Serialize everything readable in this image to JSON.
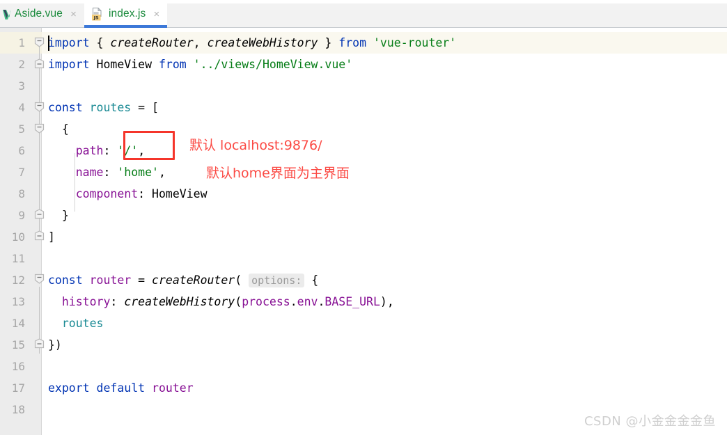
{
  "window": {
    "app": "IntelliJ-like IDE editor",
    "background_color": "#ffffff"
  },
  "tabbar": {
    "tabs": [
      {
        "label": "Aside.vue",
        "icon": "vue-file-icon",
        "close_glyph": "×",
        "active": false,
        "label_color": "#1a8a3c"
      },
      {
        "label": "index.js",
        "icon": "js-file-icon",
        "icon_badge": "JS",
        "close_glyph": "×",
        "active": true,
        "label_color": "#1a8a3c",
        "active_underline_color": "#3c78d8"
      }
    ]
  },
  "editor": {
    "gutter": {
      "line_numbers": [
        "1",
        "2",
        "3",
        "4",
        "5",
        "6",
        "7",
        "8",
        "9",
        "10",
        "11",
        "12",
        "13",
        "14",
        "15",
        "16",
        "17",
        "18"
      ]
    },
    "current_line": 1,
    "current_line_highlight_color": "#faf8ef",
    "caret_line": 1,
    "lines": [
      {
        "n": "1",
        "tokens": [
          {
            "t": "import",
            "c": "kw"
          },
          {
            "t": " ",
            "c": "pl"
          },
          {
            "t": "{",
            "c": "pl"
          },
          {
            "t": " ",
            "c": "pl"
          },
          {
            "t": "createRouter",
            "c": "fn"
          },
          {
            "t": ", ",
            "c": "pl"
          },
          {
            "t": "createWebHistory",
            "c": "fn"
          },
          {
            "t": " ",
            "c": "pl"
          },
          {
            "t": "}",
            "c": "pl"
          },
          {
            "t": " ",
            "c": "pl"
          },
          {
            "t": "from",
            "c": "kw"
          },
          {
            "t": " ",
            "c": "pl"
          },
          {
            "t": "'vue-router'",
            "c": "str"
          }
        ]
      },
      {
        "n": "2",
        "tokens": [
          {
            "t": "import",
            "c": "kw"
          },
          {
            "t": " ",
            "c": "pl"
          },
          {
            "t": "HomeView",
            "c": "pl"
          },
          {
            "t": " ",
            "c": "pl"
          },
          {
            "t": "from",
            "c": "kw"
          },
          {
            "t": " ",
            "c": "pl"
          },
          {
            "t": "'../views/HomeView.vue'",
            "c": "str"
          }
        ]
      },
      {
        "n": "3",
        "tokens": []
      },
      {
        "n": "4",
        "tokens": [
          {
            "t": "const",
            "c": "kw"
          },
          {
            "t": " ",
            "c": "pl"
          },
          {
            "t": "routes",
            "c": "cyan"
          },
          {
            "t": " = [",
            "c": "pl"
          }
        ]
      },
      {
        "n": "5",
        "tokens": [
          {
            "t": "  {",
            "c": "pl"
          }
        ]
      },
      {
        "n": "6",
        "tokens": [
          {
            "t": "    ",
            "c": "pl"
          },
          {
            "t": "path",
            "c": "prop"
          },
          {
            "t": ": ",
            "c": "pl"
          },
          {
            "t": "'/'",
            "c": "str"
          },
          {
            "t": ",",
            "c": "pl"
          }
        ]
      },
      {
        "n": "7",
        "tokens": [
          {
            "t": "    ",
            "c": "pl"
          },
          {
            "t": "name",
            "c": "prop"
          },
          {
            "t": ": ",
            "c": "pl"
          },
          {
            "t": "'home'",
            "c": "str"
          },
          {
            "t": ",",
            "c": "pl"
          }
        ]
      },
      {
        "n": "8",
        "tokens": [
          {
            "t": "    ",
            "c": "pl"
          },
          {
            "t": "component",
            "c": "prop"
          },
          {
            "t": ": ",
            "c": "pl"
          },
          {
            "t": "HomeView",
            "c": "pl"
          }
        ]
      },
      {
        "n": "9",
        "tokens": [
          {
            "t": "  }",
            "c": "pl"
          }
        ]
      },
      {
        "n": "10",
        "tokens": [
          {
            "t": "]",
            "c": "pl"
          }
        ]
      },
      {
        "n": "11",
        "tokens": []
      },
      {
        "n": "12",
        "tokens": [
          {
            "t": "const",
            "c": "kw"
          },
          {
            "t": " ",
            "c": "pl"
          },
          {
            "t": "router",
            "c": "prop"
          },
          {
            "t": " = ",
            "c": "pl"
          },
          {
            "t": "createRouter",
            "c": "fn"
          },
          {
            "t": "( ",
            "c": "pl"
          },
          {
            "t": "options:",
            "c": "hint"
          },
          {
            "t": " {",
            "c": "pl"
          }
        ]
      },
      {
        "n": "13",
        "tokens": [
          {
            "t": "  ",
            "c": "pl"
          },
          {
            "t": "history",
            "c": "prop"
          },
          {
            "t": ": ",
            "c": "pl"
          },
          {
            "t": "createWebHistory",
            "c": "fn"
          },
          {
            "t": "(",
            "c": "pl"
          },
          {
            "t": "process",
            "c": "prop"
          },
          {
            "t": ".",
            "c": "pl"
          },
          {
            "t": "env",
            "c": "prop"
          },
          {
            "t": ".",
            "c": "pl"
          },
          {
            "t": "BASE_URL",
            "c": "prop"
          },
          {
            "t": "),",
            "c": "pl"
          }
        ]
      },
      {
        "n": "14",
        "tokens": [
          {
            "t": "  ",
            "c": "pl"
          },
          {
            "t": "routes",
            "c": "cyan"
          }
        ]
      },
      {
        "n": "15",
        "tokens": [
          {
            "t": "})",
            "c": "pl"
          }
        ]
      },
      {
        "n": "16",
        "tokens": []
      },
      {
        "n": "17",
        "tokens": [
          {
            "t": "export",
            "c": "kw"
          },
          {
            "t": " ",
            "c": "pl"
          },
          {
            "t": "default",
            "c": "kw"
          },
          {
            "t": " ",
            "c": "pl"
          },
          {
            "t": "router",
            "c": "prop"
          }
        ]
      },
      {
        "n": "18",
        "tokens": []
      }
    ]
  },
  "annotations": {
    "box_color": "#f5352b",
    "text_color": "#fb4a44",
    "items": [
      {
        "text": "默认  localhost:9876/"
      },
      {
        "text": "默认home界面为主界面"
      }
    ],
    "highlight_target": "'/',"
  },
  "watermark": {
    "text": "CSDN @小金金金金鱼"
  }
}
